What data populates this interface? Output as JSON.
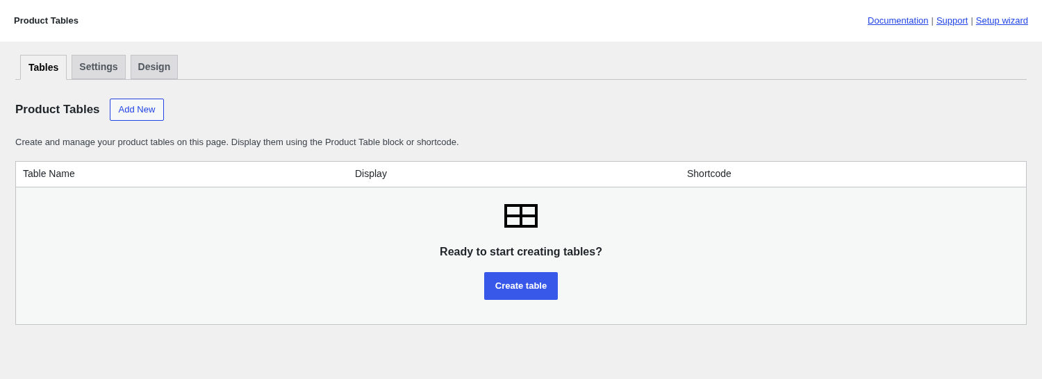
{
  "header": {
    "title": "Product Tables",
    "links": [
      {
        "label": "Documentation"
      },
      {
        "label": "Support"
      },
      {
        "label": "Setup wizard"
      }
    ],
    "separators": [
      "|",
      "|"
    ]
  },
  "tabs": [
    {
      "label": "Tables",
      "selected": true
    },
    {
      "label": "Settings",
      "selected": false
    },
    {
      "label": "Design",
      "selected": false
    }
  ],
  "page": {
    "heading": "Product Tables",
    "add_button": "Add New",
    "description": "Create and manage your product tables on this page. Display them using the Product Table block or shortcode."
  },
  "table": {
    "columns": [
      "Table Name",
      "Display",
      "Shortcode"
    ],
    "empty_state": {
      "message": "Ready to start creating tables?",
      "button": "Create table"
    }
  }
}
